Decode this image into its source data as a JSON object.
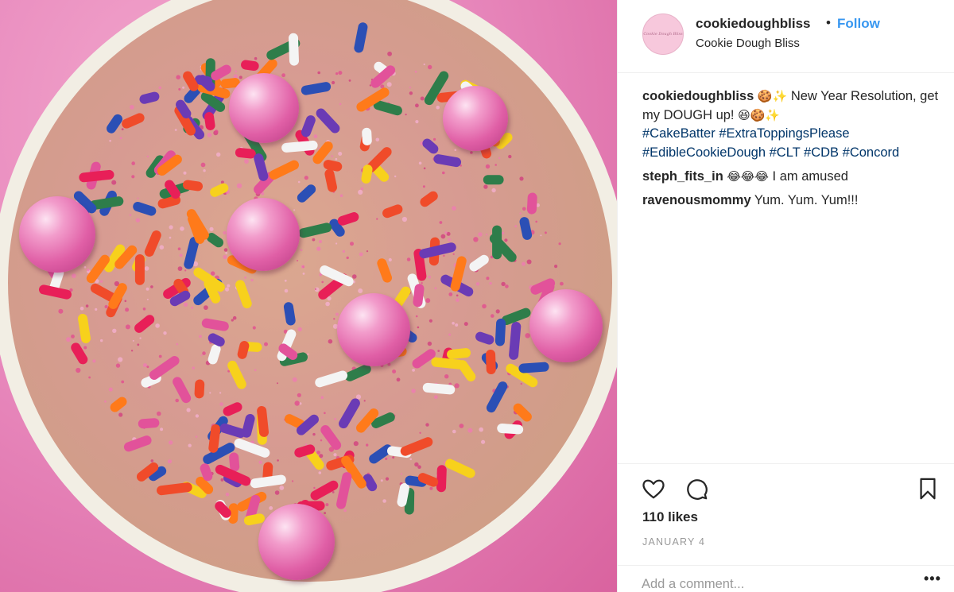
{
  "post": {
    "image_alt": "",
    "author": {
      "username": "cookiedoughbliss",
      "display_name": "Cookie Dough Bliss",
      "avatar_text": "Cookie Dough Bliss"
    },
    "separator": "•",
    "follow_label": "Follow",
    "caption": {
      "user": "cookiedoughbliss",
      "emoji_1": "🍪✨",
      "text_1": " New Year Resolution, get my DOUGH up! ",
      "emoji_2": "😆🍪✨",
      "hashtags": [
        "#CakeBatter",
        "#ExtraToppingsPlease",
        "#EdibleCookieDough",
        "#CLT",
        "#CDB",
        "#Concord"
      ]
    },
    "comments": [
      {
        "user": "steph_fits_in",
        "emoji": "😂😂😂",
        "text": " I am amused"
      },
      {
        "user": "ravenousmommy",
        "emoji": "",
        "text": " Yum. Yum. Yum!!!"
      }
    ],
    "likes_text": "110 likes",
    "date_text": "JANUARY 4",
    "comment_placeholder": "Add a comment...",
    "more_label": "•••",
    "icons": {
      "like": "heart-icon",
      "comment": "comment-icon",
      "save": "bookmark-icon"
    }
  },
  "colors": {
    "link_blue": "#3897f0",
    "hashtag": "#003569",
    "pearl_pink": "#e05fa6",
    "background_pink": "#e889bd"
  }
}
